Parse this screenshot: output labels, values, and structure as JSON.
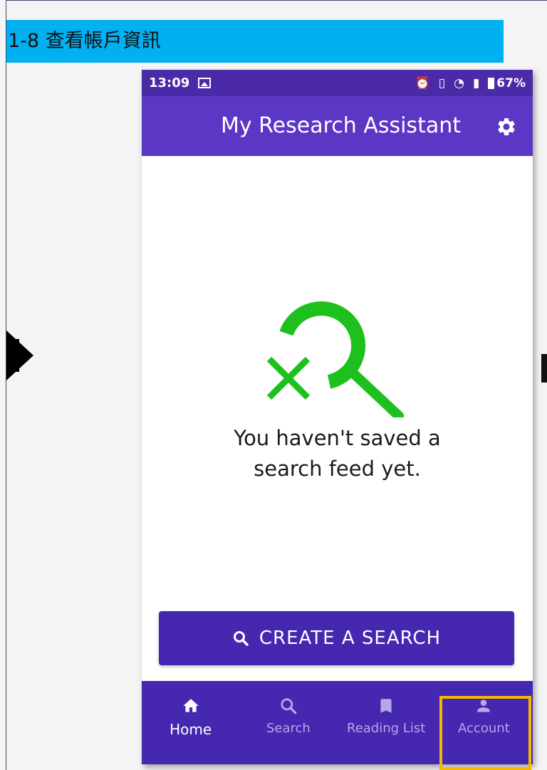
{
  "banner": {
    "title": "1-8 查看帳戶資訊"
  },
  "statusbar": {
    "time": "13:09",
    "battery": "67%"
  },
  "appbar": {
    "title": "My Research Assistant"
  },
  "empty_state": {
    "line1": "You haven't saved a",
    "line2": "search feed yet."
  },
  "create_button": {
    "label": "CREATE A SEARCH"
  },
  "nav": {
    "items": [
      {
        "label": "Home",
        "icon": "home-icon"
      },
      {
        "label": "Search",
        "icon": "search-icon"
      },
      {
        "label": "Reading List",
        "icon": "bookmark-icon"
      },
      {
        "label": "Account",
        "icon": "person-icon"
      }
    ]
  },
  "colors": {
    "banner": "#00b0f0",
    "statusbar": "#4b2aa8",
    "appbar": "#5c36c4",
    "primary": "#4527b0",
    "empty_icon": "#1ec01e",
    "highlight": "#f5b800"
  }
}
